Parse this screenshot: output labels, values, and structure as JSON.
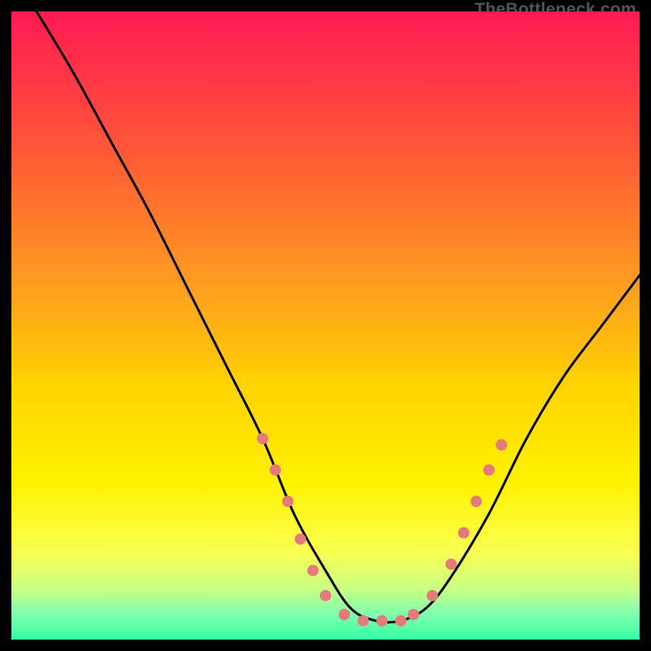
{
  "attribution": "TheBottleneck.com",
  "chart_data": {
    "type": "line",
    "title": "",
    "xlabel": "",
    "ylabel": "",
    "xlim": [
      0,
      100
    ],
    "ylim": [
      0,
      100
    ],
    "gradient_stops": [
      {
        "offset": 0,
        "color": "#ff1a54"
      },
      {
        "offset": 0.12,
        "color": "#ff3a44"
      },
      {
        "offset": 0.28,
        "color": "#ff6a30"
      },
      {
        "offset": 0.45,
        "color": "#ffa21e"
      },
      {
        "offset": 0.6,
        "color": "#ffd400"
      },
      {
        "offset": 0.75,
        "color": "#fff200"
      },
      {
        "offset": 0.86,
        "color": "#faff50"
      },
      {
        "offset": 0.92,
        "color": "#c6ff84"
      },
      {
        "offset": 0.96,
        "color": "#7dffb0"
      },
      {
        "offset": 1.0,
        "color": "#34ffa2"
      }
    ],
    "series": [
      {
        "name": "bottleneck-curve",
        "color": "#000000",
        "x": [
          4,
          10,
          16,
          22,
          28,
          34,
          40,
          45,
          50,
          54,
          58,
          62,
          66,
          70,
          76,
          82,
          88,
          94,
          100
        ],
        "y": [
          100,
          90,
          79,
          68,
          56,
          44,
          32,
          20,
          11,
          5,
          3,
          3,
          5,
          10,
          20,
          32,
          42,
          50,
          58
        ]
      }
    ],
    "markers": {
      "name": "highlight-points",
      "color": "#e47a7a",
      "radius": 7,
      "points": [
        {
          "x": 40,
          "y": 32
        },
        {
          "x": 42,
          "y": 27
        },
        {
          "x": 44,
          "y": 22
        },
        {
          "x": 46,
          "y": 16
        },
        {
          "x": 48,
          "y": 11
        },
        {
          "x": 50,
          "y": 7
        },
        {
          "x": 53,
          "y": 4
        },
        {
          "x": 56,
          "y": 3
        },
        {
          "x": 59,
          "y": 3
        },
        {
          "x": 62,
          "y": 3
        },
        {
          "x": 64,
          "y": 4
        },
        {
          "x": 67,
          "y": 7
        },
        {
          "x": 70,
          "y": 12
        },
        {
          "x": 72,
          "y": 17
        },
        {
          "x": 74,
          "y": 22
        },
        {
          "x": 76,
          "y": 27
        },
        {
          "x": 78,
          "y": 31
        }
      ]
    }
  }
}
